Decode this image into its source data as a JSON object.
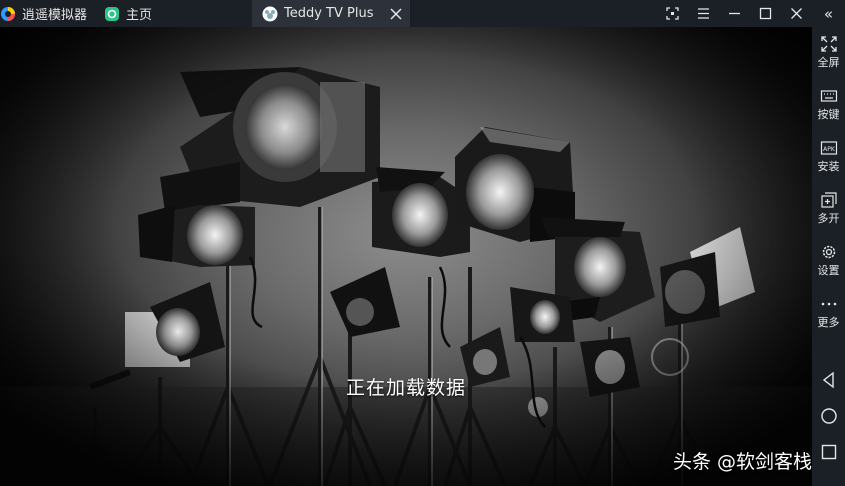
{
  "titlebar": {
    "brand": "逍遥模拟器",
    "home_tab": "主页",
    "active_tab": "Teddy TV Plus",
    "controls": [
      "screenshot-icon",
      "menu-icon",
      "minimize-icon",
      "maximize-icon",
      "close-icon"
    ]
  },
  "sidebar": {
    "items": [
      {
        "label": "全屏",
        "icon": "fullscreen-icon"
      },
      {
        "label": "按键",
        "icon": "keyboard-icon"
      },
      {
        "label": "安装",
        "icon": "apk-icon"
      },
      {
        "label": "多开",
        "icon": "multi-open-icon"
      },
      {
        "label": "设置",
        "icon": "gear-icon"
      },
      {
        "label": "更多",
        "icon": "more-icon"
      }
    ],
    "nav": [
      "back-icon",
      "home-icon",
      "recents-icon"
    ],
    "collapse": "«"
  },
  "content": {
    "loading_text": "正在加载数据",
    "watermark": "头条 @软剑客栈"
  },
  "colors": {
    "chrome": "#1b1f26",
    "active_tab": "#2c313a",
    "text": "#e6e6e6"
  }
}
